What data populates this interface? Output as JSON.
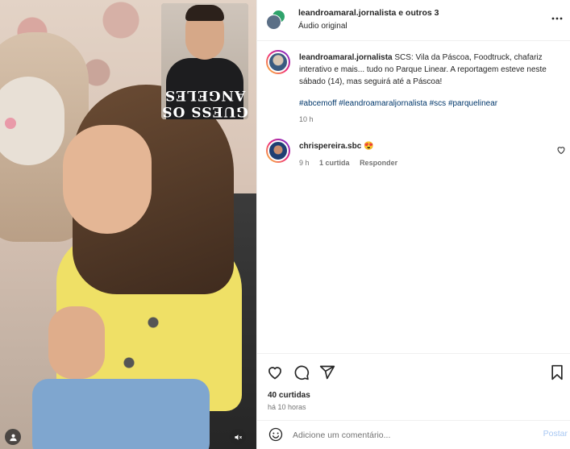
{
  "header": {
    "username": "leandroamaral.jornalista e outros 3",
    "audio": "Áudio original",
    "more_icon": "more-horizontal-icon"
  },
  "media": {
    "pip_text": "GUESS OS ANGELES",
    "tag_icon": "user-tag-icon",
    "mute_icon": "speaker-muted-icon"
  },
  "caption": {
    "username": "leandroamaral.jornalista",
    "text": " SCS: Vila da Páscoa, Foodtruck, chafariz interativo e mais... tudo no Parque Linear. A reportagem esteve neste sábado (14), mas seguirá até a Páscoa!",
    "hashtags": [
      "#abcemoff",
      "#leandroamaraljornalista",
      "#scs",
      "#parquelinear"
    ],
    "time": "10 h"
  },
  "comment": {
    "username": "chrispereira.sbc",
    "text": " 😍",
    "time": "9 h",
    "likes": "1 curtida",
    "reply": "Responder"
  },
  "actions": {
    "likes": "40 curtidas",
    "time": "há 10 horas"
  },
  "add_comment": {
    "placeholder": "Adicione um comentário...",
    "post": "Postar"
  }
}
